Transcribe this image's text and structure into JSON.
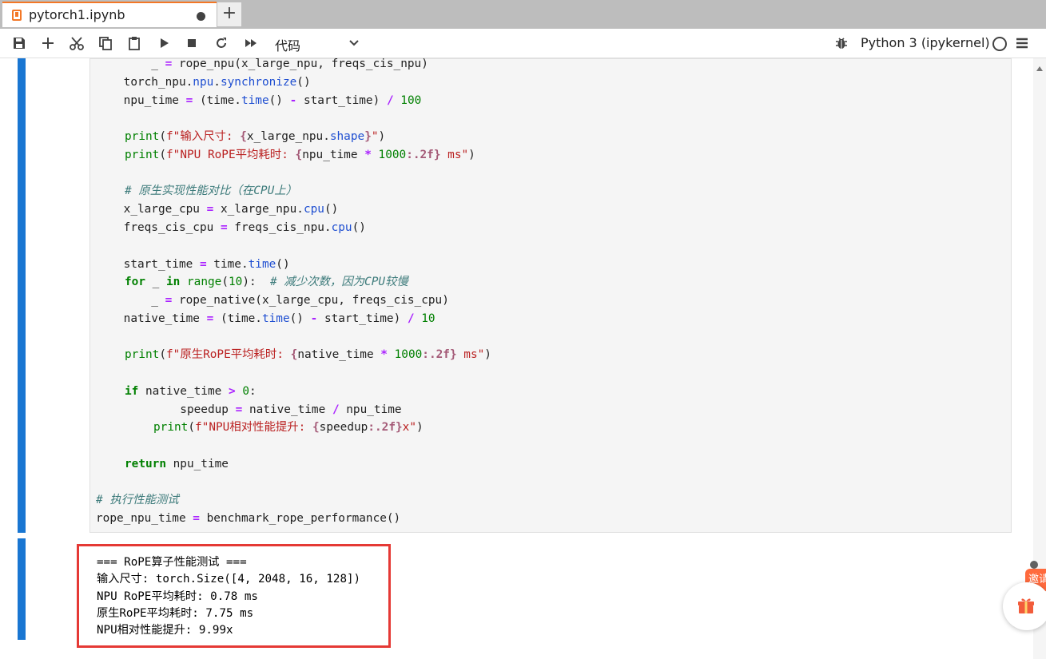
{
  "tab": {
    "title": "pytorch1.ipynb",
    "add": "+"
  },
  "toolbar": {
    "cell_type": "代码",
    "kernel": "Python 3 (ipykernel)",
    "icons": [
      "save-icon",
      "add-icon",
      "cut-icon",
      "copy-icon",
      "paste-icon",
      "run-icon",
      "stop-icon",
      "restart-icon",
      "fast-forward-icon",
      "chevron-down-icon",
      "bug-icon",
      "menu-icon"
    ]
  },
  "code": {
    "l1_a": "        _ ",
    "l1_eq": "=",
    "l1_b": " rope_npu(x_large_npu, freqs_cis_npu)",
    "l2_a": "    torch_npu.",
    "l2_attr1": "npu",
    "l2_dot": ".",
    "l2_attr2": "synchronize",
    "l2_b": "()",
    "l3_a": "    npu_time ",
    "l3_eq": "=",
    "l3_b": " (time.",
    "l3_attr": "time",
    "l3_c": "() ",
    "l3_minus": "-",
    "l3_d": " start_time) ",
    "l3_div": "/",
    "l3_sp": " ",
    "l3_num": "100",
    "l4_print": "print",
    "l4_a": "(",
    "l4_s1": "f\"输入尺寸: ",
    "l4_br1": "{",
    "l4_x": "x_large_npu.",
    "l4_attr": "shape",
    "l4_br2": "}",
    "l4_s2": "\"",
    "l4_b": ")",
    "l5_print": "print",
    "l5_a": "(",
    "l5_s1": "f\"NPU RoPE平均耗时: ",
    "l5_br1": "{",
    "l5_x": "npu_time ",
    "l5_mul": "*",
    "l5_sp": " ",
    "l5_num": "1000",
    "l5_fmt": ":.2f",
    "l5_br2": "}",
    "l5_s2": " ms\"",
    "l5_b": ")",
    "l6_comment": "# 原生实现性能对比（在CPU上）",
    "l7_a": "    x_large_cpu ",
    "l7_eq": "=",
    "l7_b": " x_large_npu.",
    "l7_attr": "cpu",
    "l7_c": "()",
    "l8_a": "    freqs_cis_cpu ",
    "l8_eq": "=",
    "l8_b": " freqs_cis_npu.",
    "l8_attr": "cpu",
    "l8_c": "()",
    "l9_a": "    start_time ",
    "l9_eq": "=",
    "l9_b": " time.",
    "l9_attr": "time",
    "l9_c": "()",
    "l10_for": "for",
    "l10_a": " _ ",
    "l10_in": "in",
    "l10_sp": " ",
    "l10_range": "range",
    "l10_b": "(",
    "l10_num": "10",
    "l10_c": "):  ",
    "l10_comment": "# 减少次数，因为CPU较慢",
    "l11_a": "        _ ",
    "l11_eq": "=",
    "l11_b": " rope_native(x_large_cpu, freqs_cis_cpu)",
    "l12_a": "    native_time ",
    "l12_eq": "=",
    "l12_b": " (time.",
    "l12_attr": "time",
    "l12_c": "() ",
    "l12_minus": "-",
    "l12_d": " start_time) ",
    "l12_div": "/",
    "l12_sp": " ",
    "l12_num": "10",
    "l13_print": "print",
    "l13_a": "(",
    "l13_s1": "f\"原生RoPE平均耗时: ",
    "l13_br1": "{",
    "l13_x": "native_time ",
    "l13_mul": "*",
    "l13_sp": " ",
    "l13_num": "1000",
    "l13_fmt": ":.2f",
    "l13_br2": "}",
    "l13_s2": " ms\"",
    "l13_b": ")",
    "l14_if": "if",
    "l14_a": " native_time ",
    "l14_gt": ">",
    "l14_sp": " ",
    "l14_num": "0",
    "l14_b": ":",
    "l15_a": "        speedup ",
    "l15_eq": "=",
    "l15_b": " native_time ",
    "l15_div": "/",
    "l15_c": " npu_time",
    "l16_print": "print",
    "l16_a": "(",
    "l16_s1": "f\"NPU相对性能提升: ",
    "l16_br1": "{",
    "l16_x": "speedup",
    "l16_fmt": ":.2f",
    "l16_br2": "}",
    "l16_s2": "x\"",
    "l16_b": ")",
    "l17_return": "return",
    "l17_a": " npu_time",
    "l18_comment": "# 执行性能测试",
    "l19_a": "rope_npu_time ",
    "l19_eq": "=",
    "l19_b": " benchmark_rope_performance()"
  },
  "output": {
    "lines": [
      "=== RoPE算子性能测试 ===",
      "输入尺寸: torch.Size([4, 2048, 16, 128])",
      "NPU RoPE平均耗时: 0.78 ms",
      "原生RoPE平均耗时: 7.75 ms",
      "NPU相对性能提升: 9.99x"
    ]
  },
  "side": {
    "invite": "邀请"
  }
}
